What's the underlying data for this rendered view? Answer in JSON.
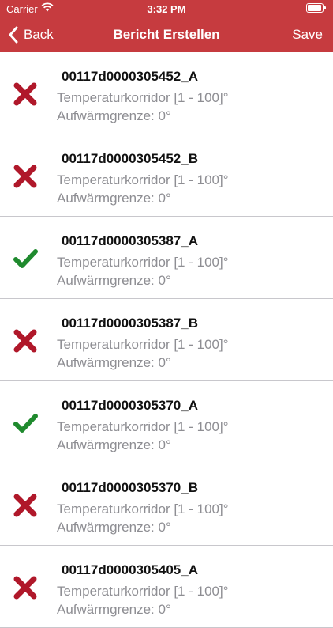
{
  "status_bar": {
    "carrier": "Carrier",
    "time": "3:32 PM"
  },
  "nav": {
    "back_label": "Back",
    "title": "Bericht Erstellen",
    "save_label": "Save"
  },
  "items": [
    {
      "title": "00117d0000305452_A",
      "line1": "Temperaturkorridor [1 - 100]°",
      "line2": "Aufwärmgrenze: 0°",
      "status": "error"
    },
    {
      "title": "00117d0000305452_B",
      "line1": "Temperaturkorridor [1 - 100]°",
      "line2": "Aufwärmgrenze: 0°",
      "status": "error"
    },
    {
      "title": "00117d0000305387_A",
      "line1": "Temperaturkorridor [1 - 100]°",
      "line2": "Aufwärmgrenze: 0°",
      "status": "ok"
    },
    {
      "title": "00117d0000305387_B",
      "line1": "Temperaturkorridor [1 - 100]°",
      "line2": "Aufwärmgrenze: 0°",
      "status": "error"
    },
    {
      "title": "00117d0000305370_A",
      "line1": "Temperaturkorridor [1 - 100]°",
      "line2": "Aufwärmgrenze: 0°",
      "status": "ok"
    },
    {
      "title": "00117d0000305370_B",
      "line1": "Temperaturkorridor [1 - 100]°",
      "line2": "Aufwärmgrenze: 0°",
      "status": "error"
    },
    {
      "title": "00117d0000305405_A",
      "line1": "Temperaturkorridor [1 - 100]°",
      "line2": "Aufwärmgrenze: 0°",
      "status": "error"
    }
  ],
  "colors": {
    "header": "#c63b3f",
    "error": "#b0182a",
    "ok": "#1f8a2e",
    "secondary_text": "#8e8e93"
  }
}
